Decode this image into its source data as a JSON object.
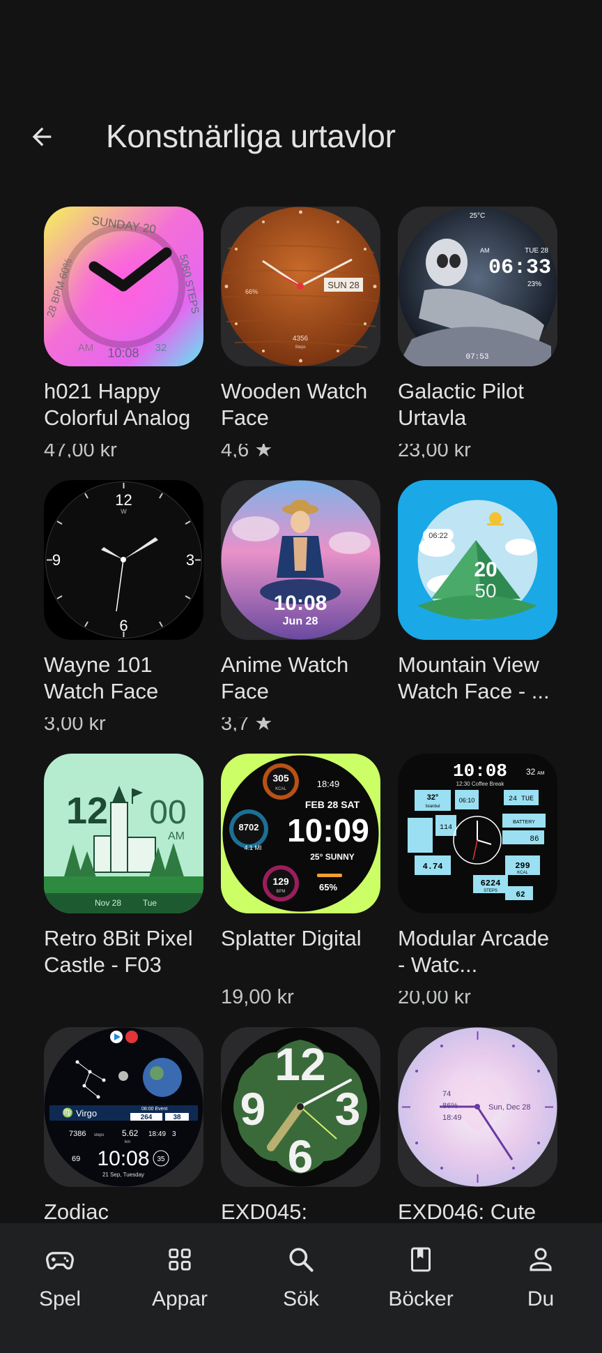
{
  "header": {
    "title": "Konstnärliga urtavlor",
    "back_icon": "arrow-back-icon"
  },
  "apps": [
    {
      "name": "h021 Happy Colorful Analog",
      "meta": "47,00 kr",
      "watch": {
        "top": "SUNDAY 20",
        "left": "28 BPM 60%",
        "right": "5060 STEPS",
        "bottom_left": "AM",
        "bottom": "10:08",
        "bottom_right": "32"
      }
    },
    {
      "name": "Wooden Watch Face",
      "meta": "4,6 ★",
      "watch": {
        "date": "SUN 28",
        "battery": "66%",
        "steps": "4356",
        "steps_label": "Steps"
      }
    },
    {
      "name": "Galactic Pilot Urtavla",
      "meta": "23,00 kr",
      "watch": {
        "temp": "25°C",
        "date": "TUE 28",
        "ampm": "AM",
        "time": "06:33",
        "battery": "23%",
        "bottom": "07:53"
      }
    },
    {
      "name": "Wayne 101 Watch Face",
      "meta": "3,00 kr",
      "watch": {
        "n12": "12",
        "n3": "3",
        "n6": "6",
        "n9": "9",
        "wm": "W"
      }
    },
    {
      "name": "Anime Watch Face",
      "meta": "3,7 ★",
      "watch": {
        "time": "10:08",
        "date": "Jun 28"
      }
    },
    {
      "name": "Mountain View Watch Face - ...",
      "meta": "",
      "watch": {
        "chip": "06:22",
        "hour": "20",
        "minute": "50"
      }
    },
    {
      "name": "Retro 8Bit Pixel Castle - F03",
      "meta": "",
      "watch": {
        "hour": "12",
        "minute": "00",
        "ampm": "AM",
        "date": "Nov 28",
        "day": "Tue"
      }
    },
    {
      "name": "Splatter Digital",
      "meta": "19,00 kr",
      "watch": {
        "kcal": "305",
        "kcal_label": "KCAL",
        "small_time": "18:49",
        "date": "FEB 28 SAT",
        "steps": "8702",
        "dist": "4.1 MI",
        "time": "10:09",
        "weather": "25° SUNNY",
        "bpm": "129",
        "bpm_label": "BPM",
        "battery": "65%"
      }
    },
    {
      "name": "Modular Arcade - Watc...",
      "meta": "20,00 kr",
      "watch": {
        "time": "10:08",
        "sec": "32",
        "ampm": "AM",
        "event": "12:30 Coffee Break",
        "temp": "32°",
        "city": "Istanbul",
        "clock": "06:10",
        "day": "24 TUE",
        "bpm": "114",
        "battery": "BATTERY",
        "bat_pct": "86",
        "dist": "4.74",
        "steps": "6224",
        "steps_label": "STEPS",
        "kcal": "299",
        "kcal_label": "KCAL",
        "pct": "62"
      }
    },
    {
      "name": "Zodiac",
      "meta": "",
      "watch": {
        "sign": "Virgo",
        "event": "08:00 Event",
        "v1": "264",
        "v2": "38",
        "steps": "7386",
        "steps_label": "steps",
        "km": "5.62",
        "km_label": "km",
        "t": "18:49",
        "n3": "3",
        "bpm": "69",
        "time": "10:08",
        "sec": "35",
        "date": "21 Sep, Tuesday"
      }
    },
    {
      "name": "EXD045:",
      "meta": "",
      "watch": {
        "n12": "12",
        "n9": "9",
        "n3": "3",
        "n6": "6"
      }
    },
    {
      "name": "EXD046: Cute",
      "meta": "",
      "watch": {
        "steps": "74",
        "battery": "86%",
        "time": "18:49",
        "date": "Sun, Dec 28"
      }
    }
  ],
  "bottom_nav": {
    "items": [
      {
        "label": "Spel",
        "icon": "gamepad-icon"
      },
      {
        "label": "Appar",
        "icon": "apps-grid-icon"
      },
      {
        "label": "Sök",
        "icon": "search-icon"
      },
      {
        "label": "Böcker",
        "icon": "book-icon"
      },
      {
        "label": "Du",
        "icon": "person-icon"
      }
    ]
  }
}
